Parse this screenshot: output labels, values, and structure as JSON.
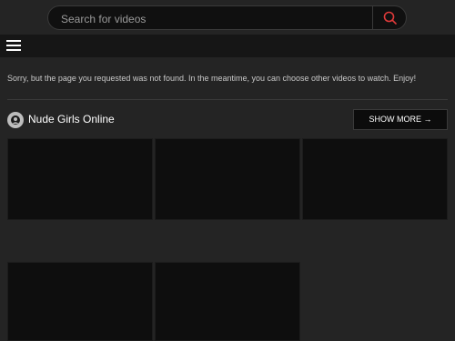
{
  "header": {
    "search": {
      "placeholder": "Search for videos",
      "value": ""
    }
  },
  "notice": "Sorry, but the page you requested was not found. In the meantime, you can choose other videos to watch. Enjoy!",
  "section": {
    "title": "Nude Girls Online",
    "show_more_label": "SHOW MORE →"
  },
  "colors": {
    "background": "#242424",
    "accent_search_icon": "#e03a3a"
  }
}
